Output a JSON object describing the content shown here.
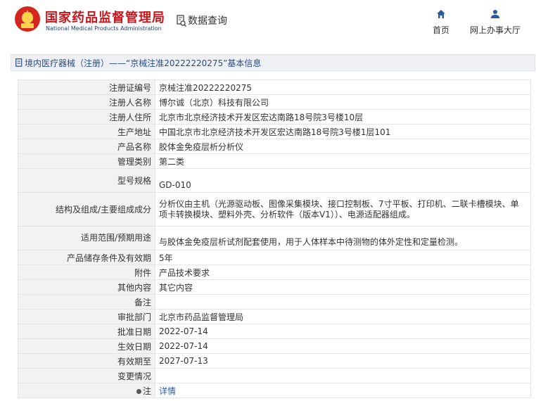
{
  "header": {
    "site_title_cn": "国家药品监督管理局",
    "site_title_en": "National Medical Products Administration",
    "data_query_label": "数据查询",
    "nav": {
      "home_label": "首页",
      "hall_label": "网上办事大厅"
    }
  },
  "breadcrumb": {
    "text": "境内医疗器械（注册）——“京械注准20222220275”基本信息"
  },
  "details": [
    {
      "label": "注册证编号",
      "value": "京械注准20222220275"
    },
    {
      "label": "注册人名称",
      "value": "博尔诚（北京）科技有限公司"
    },
    {
      "label": "注册人住所",
      "value": "北京市北京经济技术开发区宏达南路18号院3号楼10层"
    },
    {
      "label": "生产地址",
      "value": "中国北京市北京经济技术开发区宏达南路18号院3号楼1层101"
    },
    {
      "label": "产品名称",
      "value": "胶体金免疫层析分析仪"
    },
    {
      "label": "管理类别",
      "value": "第二类"
    },
    {
      "label": "型号规格",
      "value": "GD-010"
    },
    {
      "label": "结构及组成/主要组成成分",
      "value": "分析仪由主机（光源驱动板、图像采集模块、接口控制板、7寸平板、打印机、二联卡槽模块、单项卡转换模块、塑料外壳、分析软件（版本V1））、电源适配器组成。"
    },
    {
      "label": "适用范围/预期用途",
      "value": "与胶体金免疫层析试剂配套使用，用于人体样本中待测物的体外定性和定量检测。"
    },
    {
      "label": "产品储存条件及有效期",
      "value": "5年"
    },
    {
      "label": "附件",
      "value": "产品技术要求"
    },
    {
      "label": "其他内容",
      "value": "其它内容"
    },
    {
      "label": "备注",
      "value": ""
    },
    {
      "label": "审批部门",
      "value": "北京市药品监督管理局"
    },
    {
      "label": "批准日期",
      "value": "2022-07-14"
    },
    {
      "label": "生效日期",
      "value": "2022-07-14"
    },
    {
      "label": "有效期至",
      "value": "2027-07-13"
    },
    {
      "label": "变更情况",
      "value": ""
    },
    {
      "label": "注",
      "value": "详情"
    }
  ]
}
